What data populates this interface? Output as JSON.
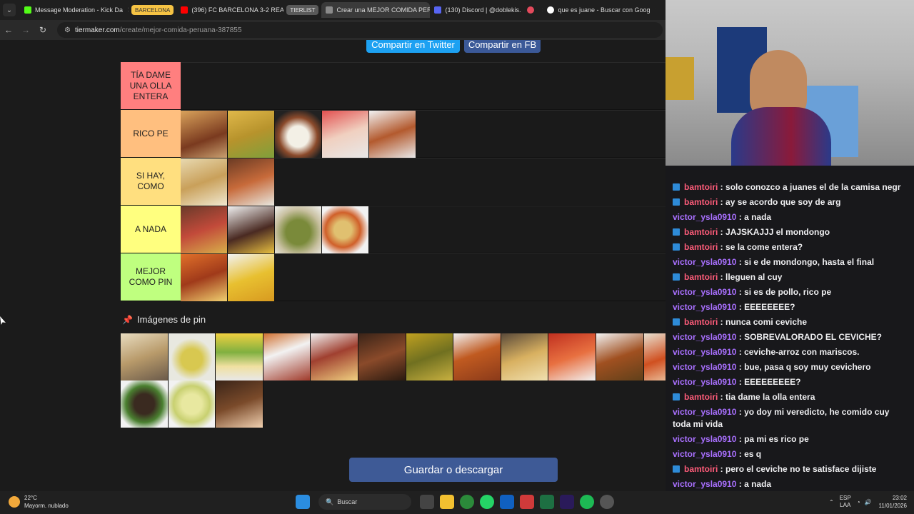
{
  "browser": {
    "tabs": [
      {
        "label": "Message Moderation - Kick Da",
        "color": "#53fc18"
      },
      {
        "label": "(396) FC BARCELONA 3-2 REAL",
        "color": "#ff0000"
      },
      {
        "label": "Crear una MEJOR COMIDA PER",
        "color": "#8a8a8a"
      },
      {
        "label": "(130) Discord | @doblekis.",
        "color": "#5865f2"
      },
      {
        "label": "que es juane - Buscar con Goog",
        "color": "#ffffff"
      }
    ],
    "groups": [
      "BARCELONA",
      "TIERLIST"
    ],
    "url_domain": "tiermaker.com",
    "url_path": "/create/mejor-comida-peruana-387855"
  },
  "page": {
    "share_twitter": "Compartir en Twitter",
    "share_fb": "Compartir en FB",
    "tiers": [
      {
        "label": "TÍA DAME UNA OLLA ENTERA",
        "color": "#ff7f7f",
        "items": 0
      },
      {
        "label": "RICO PE",
        "color": "#ffbf7f",
        "items": 5
      },
      {
        "label": "SI HAY, COMO",
        "color": "#ffdf7f",
        "items": 2
      },
      {
        "label": "A NADA",
        "color": "#ffff7f",
        "items": 4
      },
      {
        "label": "MEJOR COMO PIN",
        "color": "#bfff7f",
        "items": 2
      }
    ],
    "pin_title": "Imágenes de pin",
    "save_button": "Guardar o descargar"
  },
  "chat": {
    "messages": [
      {
        "user": "bamtoiri",
        "text": "solo conozco a juanes el de la camisa negr",
        "color": "red",
        "badge": true
      },
      {
        "user": "bamtoiri",
        "text": "ay se acordo que soy de arg",
        "color": "red",
        "badge": true
      },
      {
        "user": "victor_ysla0910",
        "text": "a nada",
        "color": "purple",
        "badge": false
      },
      {
        "user": "bamtoiri",
        "text": "JAJSKAJJJ el mondongo",
        "color": "red",
        "badge": true
      },
      {
        "user": "bamtoiri",
        "text": "se la come entera?",
        "color": "red",
        "badge": true
      },
      {
        "user": "victor_ysla0910",
        "text": "si e de mondongo, hasta el final",
        "color": "purple",
        "badge": false
      },
      {
        "user": "bamtoiri",
        "text": "lleguen al cuy",
        "color": "red",
        "badge": true
      },
      {
        "user": "victor_ysla0910",
        "text": "si es de pollo, rico pe",
        "color": "purple",
        "badge": false
      },
      {
        "user": "victor_ysla0910",
        "text": "EEEEEEEE?",
        "color": "purple",
        "badge": false
      },
      {
        "user": "bamtoiri",
        "text": "nunca comi ceviche",
        "color": "red",
        "badge": true
      },
      {
        "user": "victor_ysla0910",
        "text": "SOBREVALORADO EL CEVICHE?",
        "color": "purple",
        "badge": false
      },
      {
        "user": "victor_ysla0910",
        "text": "ceviche-arroz con mariscos.",
        "color": "purple",
        "badge": false
      },
      {
        "user": "victor_ysla0910",
        "text": "bue, pasa q soy muy cevichero",
        "color": "purple",
        "badge": false
      },
      {
        "user": "victor_ysla0910",
        "text": "EEEEEEEEE?",
        "color": "purple",
        "badge": false
      },
      {
        "user": "bamtoiri",
        "text": "tia dame la olla entera",
        "color": "red",
        "badge": true
      },
      {
        "user": "victor_ysla0910",
        "text": "yo doy mi veredicto, he comido cuy toda mi vida",
        "color": "purple",
        "badge": false
      },
      {
        "user": "victor_ysla0910",
        "text": "pa mi es rico pe",
        "color": "purple",
        "badge": false
      },
      {
        "user": "victor_ysla0910",
        "text": "es q",
        "color": "purple",
        "badge": false
      },
      {
        "user": "bamtoiri",
        "text": "pero el ceviche no te satisface dijiste",
        "color": "red",
        "badge": true
      },
      {
        "user": "victor_ysla0910",
        "text": "a nada",
        "color": "purple",
        "badge": false
      }
    ]
  },
  "taskbar": {
    "temp": "22°C",
    "weather": "Mayorm. nublado",
    "search": "Buscar",
    "lang": "ESP",
    "lang2": "LAA",
    "time": "23:02",
    "date": "11/01/2026"
  }
}
